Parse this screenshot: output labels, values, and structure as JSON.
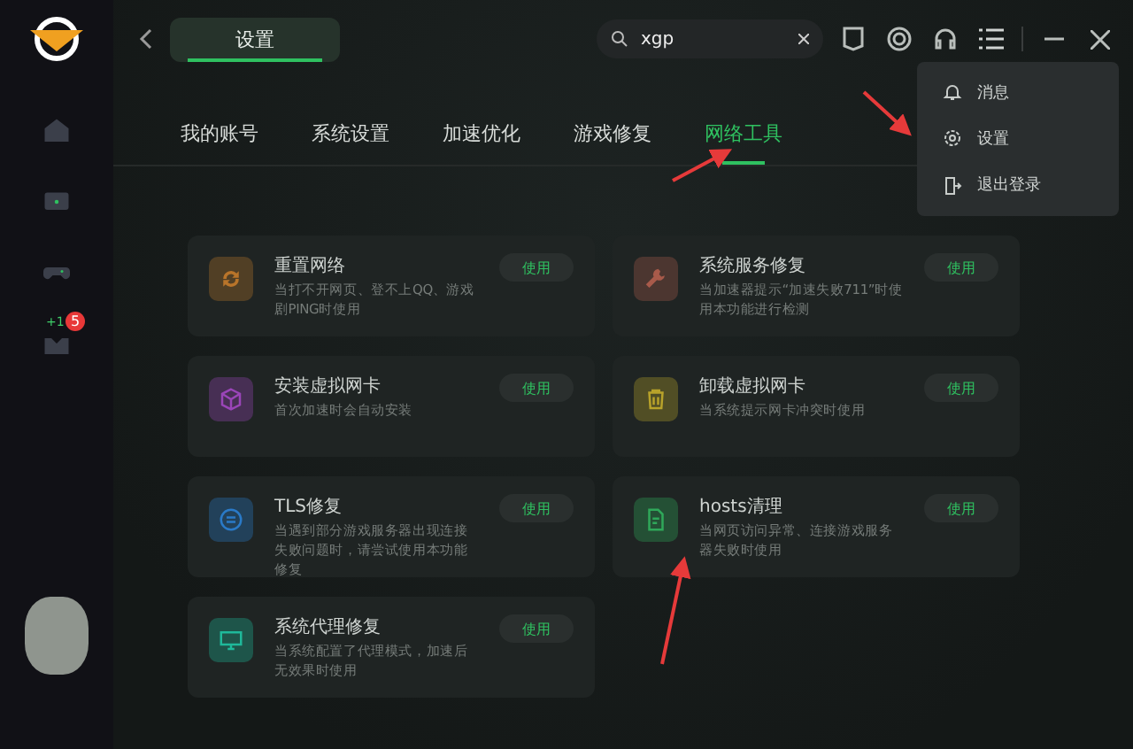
{
  "sidebar": {
    "items": [
      {
        "kind": "home",
        "selected": false
      },
      {
        "kind": "screen",
        "selected": false
      },
      {
        "kind": "gamepad",
        "selected": false
      },
      {
        "kind": "inbox",
        "selected": false,
        "tag": "+1",
        "badge": "5"
      }
    ]
  },
  "topbar": {
    "page_tab": "设置",
    "search": {
      "value": "xgp"
    }
  },
  "menu": {
    "items": [
      {
        "kind": "bell",
        "label": "消息"
      },
      {
        "kind": "gear",
        "label": "设置"
      },
      {
        "kind": "exit",
        "label": "退出登录"
      }
    ]
  },
  "tabs": [
    {
      "label": "我的账号",
      "selected": false
    },
    {
      "label": "系统设置",
      "selected": false
    },
    {
      "label": "加速优化",
      "selected": false
    },
    {
      "label": "游戏修复",
      "selected": false
    },
    {
      "label": "网络工具",
      "selected": true
    }
  ],
  "tools": [
    {
      "kind": "refresh",
      "color": "#b8742a",
      "title": "重置网络",
      "desc": "当打不开网页、登不上QQ、游戏剧PING时使用",
      "button": "使用"
    },
    {
      "kind": "wrench",
      "color": "#a85a4a",
      "title": "系统服务修复",
      "desc": "当加速器提示“加速失败711”时使用本功能进行检测",
      "button": "使用"
    },
    {
      "kind": "cube",
      "color": "#9a45b8",
      "title": "安装虚拟网卡",
      "desc": "首次加速时会自动安装",
      "button": "使用"
    },
    {
      "kind": "trash",
      "color": "#b8a22a",
      "title": "卸载虚拟网卡",
      "desc": "当系统提示网卡冲突时使用",
      "button": "使用"
    },
    {
      "kind": "tls",
      "color": "#2a7ac8",
      "title": "TLS修复",
      "desc": "当遇到部分游戏服务器出现连接失败问题时，请尝试使用本功能修复",
      "button": "使用"
    },
    {
      "kind": "file",
      "color": "#2fa85a",
      "title": "hosts清理",
      "desc": "当网页访问异常、连接游戏服务器失败时使用",
      "button": "使用"
    },
    {
      "kind": "monitor",
      "color": "#1fb89a",
      "title": "系统代理修复",
      "desc": "当系统配置了代理模式，加速后无效果时使用",
      "button": "使用"
    }
  ]
}
